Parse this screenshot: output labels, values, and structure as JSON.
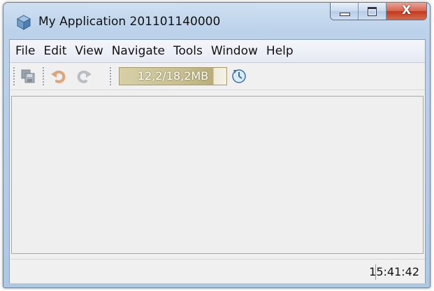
{
  "window": {
    "title": "My Application 201101140000",
    "buttons": {
      "minimize_icon": "minimize-icon",
      "maximize_icon": "maximize-icon",
      "close_icon": "close-icon",
      "close_glyph": "X"
    }
  },
  "menubar": {
    "items": [
      "File",
      "Edit",
      "View",
      "Navigate",
      "Tools",
      "Window",
      "Help"
    ]
  },
  "toolbar": {
    "buttons": [
      {
        "icon": "save-all-icon",
        "enabled": false
      },
      {
        "icon": "undo-icon",
        "enabled": false
      },
      {
        "icon": "redo-icon",
        "enabled": false
      }
    ],
    "memory_usage": "12,2/18,2MB",
    "memory_used_fraction": 0.67,
    "gc_icon": "garbage-collect-icon"
  },
  "statusbar": {
    "clock": "15:41:42"
  },
  "colors": {
    "frame": "#bcd2ea",
    "close_button": "#c2391c",
    "memory_bar": "#c7be90"
  }
}
